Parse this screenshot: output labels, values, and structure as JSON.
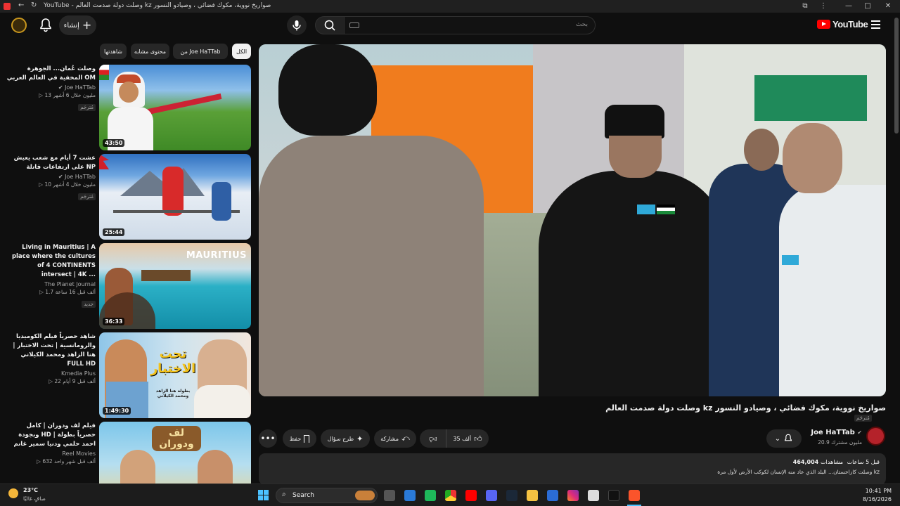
{
  "window": {
    "title": "YouTube - وصلت دولة صدمت العالم kz صواريخ نووية، مكوك فضائي ، وصيادو النسور"
  },
  "topbar": {
    "create_label": "إنشاء",
    "search_placeholder": "بحث",
    "logo_text": "YouTube"
  },
  "chips": [
    {
      "label": "الكل"
    },
    {
      "label": "من Joe HaTTab"
    },
    {
      "label": "محتوى مشابه"
    },
    {
      "label": "شاهدتها"
    }
  ],
  "related": [
    {
      "title": "وصلت عُمان... الجوهرة المخفية في العالم العربي OM",
      "channel": "Joe HaTTab",
      "stats": "13 مليون  خلال 6 أشهر",
      "badge": "مُترجَم",
      "duration": "43:50"
    },
    {
      "title": "عشت 7 أيام مع شعب يعيش على ارتفاعات قاتلة NP",
      "channel": "Joe HaTTab",
      "stats": "10 مليون  خلال 4 أشهر",
      "badge": "مُترجَم",
      "duration": "25:44"
    },
    {
      "title": "Living in Mauritius | A place where the cultures of 4 CONTINENTS intersect | 4K ...",
      "channel": "The Planet Journal",
      "stats": "1.7 ألف  قبل 16 ساعة",
      "badge": "جديد",
      "duration": "36:33"
    },
    {
      "title": "شاهد حصرياً فيلم الكوميديا والرومانسية | تحت الاختبار | هنا الزاهد ومحمد الكيلاني FULL HD",
      "channel": "Kmedia Plus",
      "stats": "22 ألف  قبل 9 أيام",
      "badge": "",
      "duration": "1:49:30"
    },
    {
      "title": "فيلم لف ودوران | كامل وبجودة HD | حصرياً بطولة احمد حلمي ودنيا سمير غانم",
      "channel": "Reel Movies",
      "stats": "632 ألف  قبل شهر واحد",
      "badge": "",
      "duration": ""
    }
  ],
  "thumb_texts": {
    "mauritius": "MAURITIUS",
    "tahta": "تحت الاختبار",
    "tahta_sub": "بطولة هنا الزاهد ومحمد الكيلاني",
    "laff": "لف ودوران"
  },
  "video": {
    "title": "وصلت دولة صدمت العالم kz صواريخ نووية، مكوك فضائي ، وصيادو النسور",
    "badge": "مُترجَم",
    "channel": "Joe HaTTab",
    "subscribers": "20.9 مليون مشترك",
    "likes": "35 ألف",
    "share": "مشاركة",
    "ask": "طرح سؤال",
    "save": "حفظ",
    "views": "464,004",
    "views_label": "مشاهدات",
    "time_ago": "قبل 5 ساعات",
    "desc_line": "وصلت كازاخستان... البلد الذي عاد منه الإنسان لكوكب الأرض لأول مرة kz"
  },
  "taskbar": {
    "weather_temp": "23°C",
    "weather_text": "صافٍ غالبًا",
    "search_label": "Search",
    "time": "10:41 PM",
    "date": "8/16/2026"
  }
}
